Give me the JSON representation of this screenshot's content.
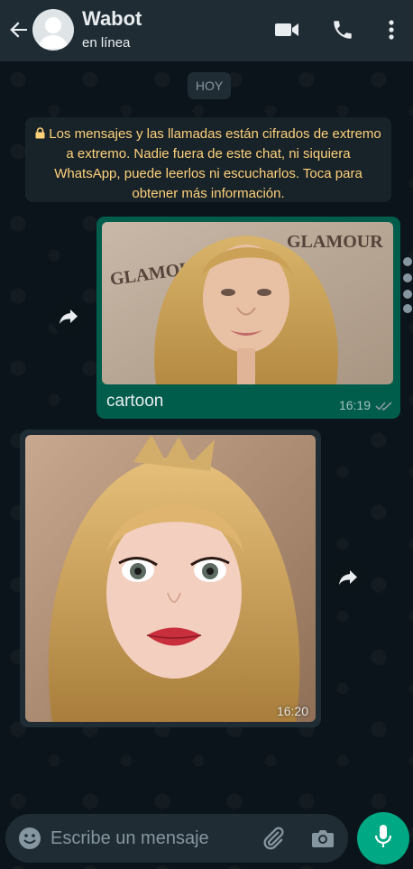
{
  "header": {
    "contact_name": "Wabot",
    "status": "en línea",
    "icons": [
      "back-arrow-icon",
      "video-call-icon",
      "phone-icon",
      "more-vert-icon"
    ]
  },
  "chat": {
    "day_label": "HOY",
    "encryption_notice": "Los mensajes y las llamadas están cifrados de extremo a extremo. Nadie fuera de este chat, ni siquiera WhatsApp, puede leerlos ni escucharlos. Toca para obtener más información.",
    "messages": [
      {
        "direction": "outgoing",
        "type": "image",
        "caption": "cartoon",
        "time": "16:19",
        "status": "read"
      },
      {
        "direction": "incoming",
        "type": "image",
        "caption": "",
        "time": "16:20"
      }
    ]
  },
  "composer": {
    "placeholder": "Escribe un mensaje"
  },
  "colors": {
    "header_bg": "#1f2c34",
    "chat_bg": "#0b141a",
    "outgoing_bubble": "#005c4b",
    "incoming_bubble": "#1f2c34",
    "accent": "#00a884",
    "notice_text": "#ffd279"
  }
}
